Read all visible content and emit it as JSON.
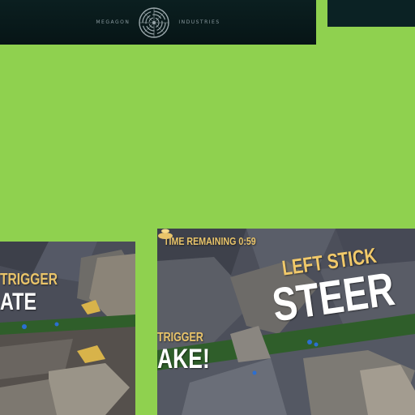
{
  "banner": {
    "left_word": "MEGAGON",
    "right_word": "INDUSTRIES",
    "logo_icon": "concentric-maze-logo-icon"
  },
  "screens": {
    "left": {
      "trigger_label": "TRIGGER",
      "action_label": "ATE"
    },
    "right": {
      "time_remaining": "TIME REMAINING 0:59",
      "stick_label": "LEFT STICK",
      "stick_icon": "controller-stick-icon",
      "steer_label": "STEER",
      "trigger_label": "TRIGGER",
      "action_label": "AKE!"
    }
  },
  "colors": {
    "background": "#8fd14f",
    "banner": "#071516",
    "hud_yellow": "#e9c46a",
    "hud_white": "#ffffff"
  }
}
